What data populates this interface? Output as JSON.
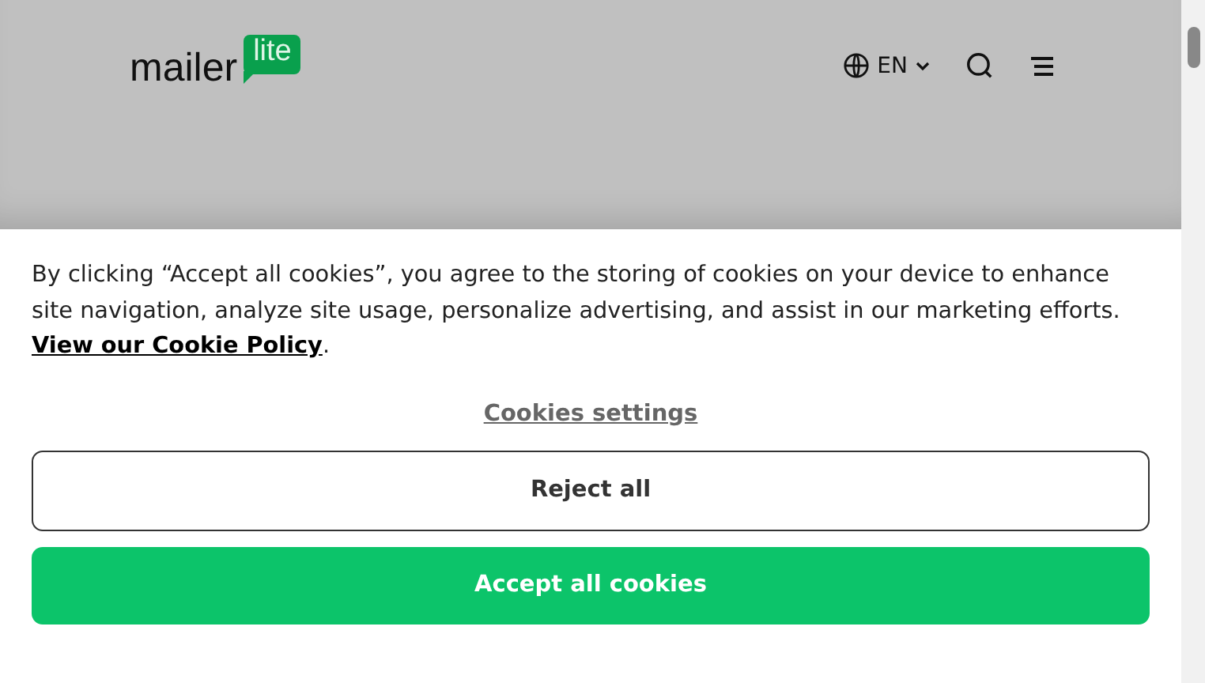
{
  "header": {
    "logo_word": "mailer",
    "logo_badge": "lite",
    "language": "EN"
  },
  "cookie_banner": {
    "message": "By clicking “Accept all cookies”, you agree to the storing of cookies on your device to enhance site navigation, analyze site usage, personalize advertising, and assist in our marketing efforts.",
    "policy_link": "View our Cookie Policy",
    "after_link": ".",
    "settings_link": "Cookies settings",
    "buttons": [
      {
        "label": "Reject all",
        "kind": "outline"
      },
      {
        "label": "Accept all cookies",
        "kind": "primary"
      }
    ]
  }
}
